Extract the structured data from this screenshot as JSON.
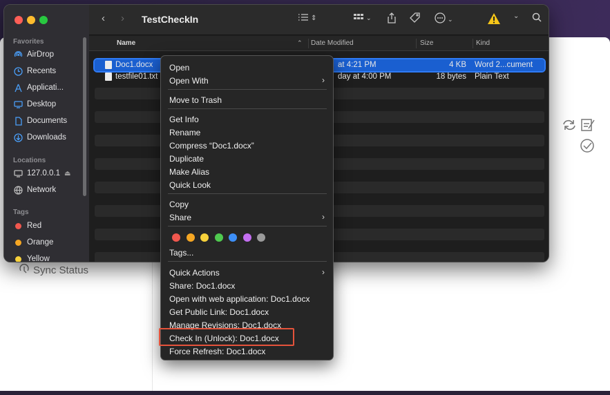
{
  "background_app": {
    "sync_status_label": "Sync Status"
  },
  "finder": {
    "title": "TestCheckIn",
    "sidebar": {
      "favorites_header": "Favorites",
      "favorites": [
        {
          "label": "AirDrop",
          "icon": "airdrop-icon"
        },
        {
          "label": "Recents",
          "icon": "clock-icon"
        },
        {
          "label": "Applicati...",
          "icon": "applications-icon"
        },
        {
          "label": "Desktop",
          "icon": "desktop-icon"
        },
        {
          "label": "Documents",
          "icon": "document-icon"
        },
        {
          "label": "Downloads",
          "icon": "download-icon"
        }
      ],
      "locations_header": "Locations",
      "locations": [
        {
          "label": "127.0.0.1",
          "icon": "monitor-icon",
          "eject": "⏏"
        },
        {
          "label": "Network",
          "icon": "network-icon"
        }
      ],
      "tags_header": "Tags",
      "tags": [
        {
          "label": "Red",
          "color": "#f0574e"
        },
        {
          "label": "Orange",
          "color": "#f5a623"
        },
        {
          "label": "Yellow",
          "color": "#f7d13b"
        }
      ]
    },
    "columns": {
      "name": "Name",
      "date_modified": "Date Modified",
      "size": "Size",
      "kind": "Kind"
    },
    "files": [
      {
        "name": "Doc1.docx",
        "date": "at 4:21 PM",
        "size": "4 KB",
        "kind": "Word 2...cument",
        "selected": true
      },
      {
        "name": "testfile01.txt",
        "date": "day at 4:00 PM",
        "size": "18 bytes",
        "kind": "Plain Text",
        "selected": false
      }
    ]
  },
  "context_menu": {
    "items": {
      "open": "Open",
      "open_with": "Open With",
      "move_to_trash": "Move to Trash",
      "get_info": "Get Info",
      "rename": "Rename",
      "compress": "Compress “Doc1.docx”",
      "duplicate": "Duplicate",
      "make_alias": "Make Alias",
      "quick_look": "Quick Look",
      "copy": "Copy",
      "share": "Share",
      "tags": "Tags...",
      "quick_actions": "Quick Actions",
      "share_doc": "Share: Doc1.docx",
      "open_web": "Open with web application: Doc1.docx",
      "get_public_link": "Get Public Link: Doc1.docx",
      "manage_revisions": "Manage Revisions: Doc1.docx",
      "check_in": "Check In (Unlock): Doc1.docx",
      "force_refresh": "Force Refresh: Doc1.docx"
    },
    "submenu_chevron": "›",
    "tag_colors": [
      "#f0574e",
      "#f5a623",
      "#f7d13b",
      "#4fc94f",
      "#3d8ff7",
      "#c36ef0",
      "#9a9a9a"
    ]
  }
}
